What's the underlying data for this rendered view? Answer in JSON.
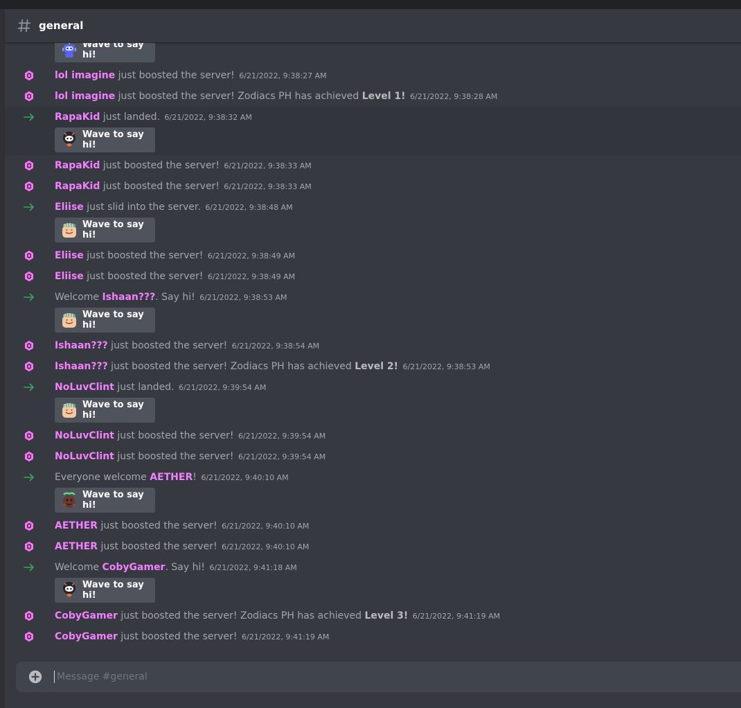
{
  "channel": {
    "name": "general"
  },
  "wave_label": "Wave to say hi!",
  "composer": {
    "placeholder": "Message #general"
  },
  "messages": [
    {
      "kind": "wave",
      "sticker": "robot-sticker"
    },
    {
      "kind": "boost",
      "user": "lol imagine",
      "text": " just boosted the server!",
      "time": "6/21/2022, 9:38:27 AM"
    },
    {
      "kind": "boost",
      "user": "lol imagine",
      "text": " just boosted the server! Zodiacs PH has achieved ",
      "bold": "Level 1!",
      "time": "6/21/2022, 9:38:28 AM"
    },
    {
      "kind": "join",
      "user": "RapaKid",
      "text": " just landed.",
      "time": "6/21/2022, 9:38:32 AM",
      "hl": true
    },
    {
      "kind": "wave",
      "sticker": "black-character-sticker",
      "hl": true
    },
    {
      "kind": "boost",
      "user": "RapaKid",
      "text": " just boosted the server!",
      "time": "6/21/2022, 9:38:33 AM"
    },
    {
      "kind": "boost",
      "user": "RapaKid",
      "text": " just boosted the server!",
      "time": "6/21/2022, 9:38:33 AM"
    },
    {
      "kind": "join",
      "user": "Eliise",
      "text": " just slid into the server.",
      "time": "6/21/2022, 9:38:48 AM"
    },
    {
      "kind": "wave",
      "sticker": "waving-hand-sticker"
    },
    {
      "kind": "boost",
      "user": "Eliise",
      "text": " just boosted the server!",
      "time": "6/21/2022, 9:38:49 AM"
    },
    {
      "kind": "boost",
      "user": "Eliise",
      "text": " just boosted the server!",
      "time": "6/21/2022, 9:38:49 AM"
    },
    {
      "kind": "join",
      "pre": "Welcome ",
      "user": "Ishaan???",
      "text": ". Say hi!",
      "time": "6/21/2022, 9:38:53 AM"
    },
    {
      "kind": "wave",
      "sticker": "waving-hand-sticker"
    },
    {
      "kind": "boost",
      "user": "Ishaan???",
      "text": " just boosted the server!",
      "time": "6/21/2022, 9:38:54 AM"
    },
    {
      "kind": "boost",
      "user": "Ishaan???",
      "text": " just boosted the server! Zodiacs PH has achieved ",
      "bold": "Level 2!",
      "time": "6/21/2022, 9:38:53 AM"
    },
    {
      "kind": "join",
      "user": "NoLuvClint",
      "text": " just landed.",
      "time": "6/21/2022, 9:39:54 AM"
    },
    {
      "kind": "wave",
      "sticker": "waving-hand-sticker"
    },
    {
      "kind": "boost",
      "user": "NoLuvClint",
      "text": " just boosted the server!",
      "time": "6/21/2022, 9:39:54 AM"
    },
    {
      "kind": "boost",
      "user": "NoLuvClint",
      "text": " just boosted the server!",
      "time": "6/21/2022, 9:39:54 AM"
    },
    {
      "kind": "join",
      "pre": "Everyone welcome ",
      "user": "AETHER",
      "text": "!",
      "time": "6/21/2022, 9:40:10 AM"
    },
    {
      "kind": "wave",
      "sticker": "sup-sticker"
    },
    {
      "kind": "boost",
      "user": "AETHER",
      "text": " just boosted the server!",
      "time": "6/21/2022, 9:40:10 AM"
    },
    {
      "kind": "boost",
      "user": "AETHER",
      "text": " just boosted the server!",
      "time": "6/21/2022, 9:40:10 AM"
    },
    {
      "kind": "join",
      "pre": "Welcome ",
      "user": "CobyGamer",
      "text": ". Say hi!",
      "time": "6/21/2022, 9:41:18 AM"
    },
    {
      "kind": "wave",
      "sticker": "black-character-sticker"
    },
    {
      "kind": "boost",
      "user": "CobyGamer",
      "text": " just boosted the server! Zodiacs PH has achieved ",
      "bold": "Level 3!",
      "time": "6/21/2022, 9:41:19 AM"
    },
    {
      "kind": "boost",
      "user": "CobyGamer",
      "text": " just boosted the server!",
      "time": "6/21/2022, 9:41:19 AM"
    }
  ]
}
